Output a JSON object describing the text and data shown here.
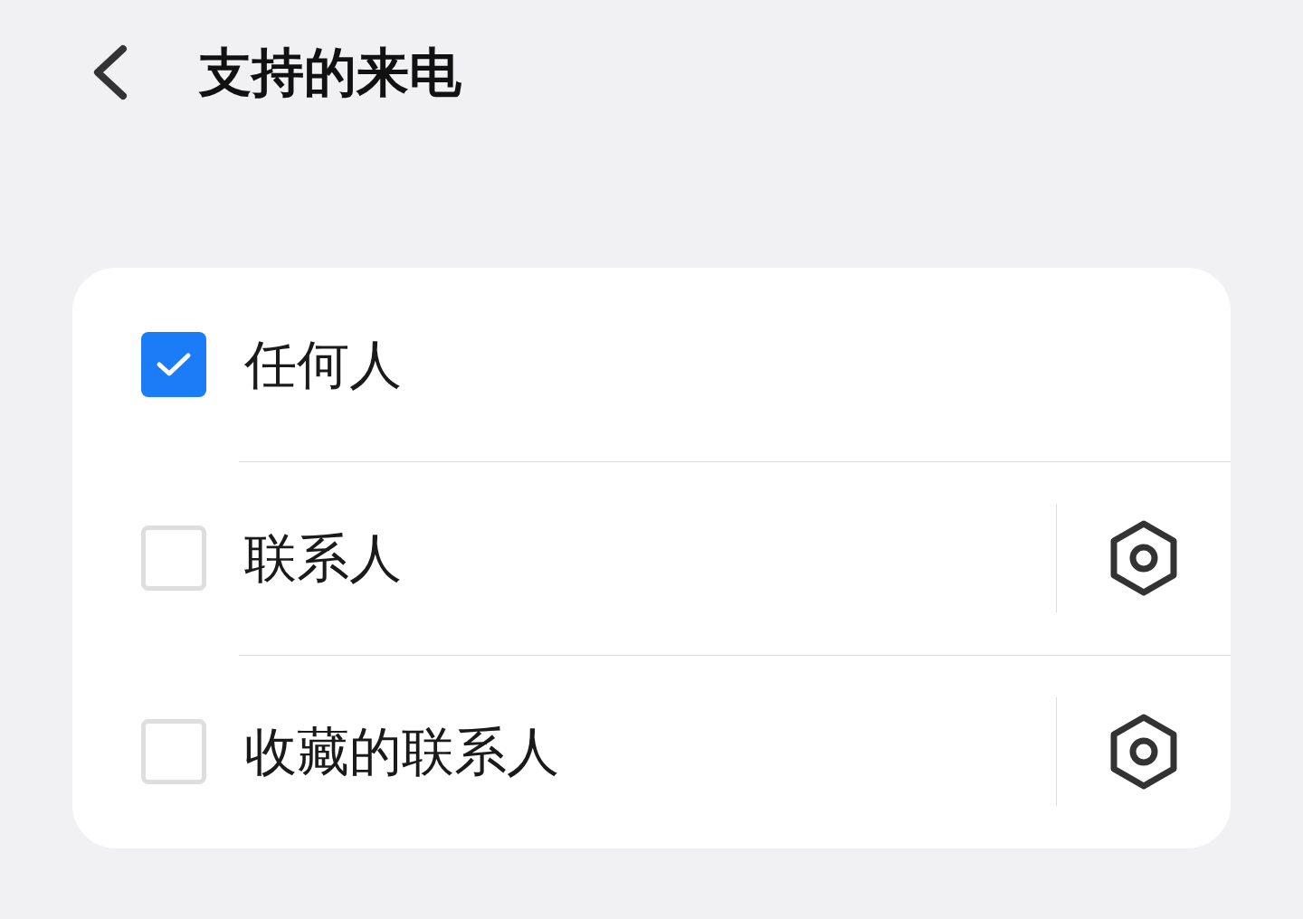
{
  "header": {
    "title": "支持的来电"
  },
  "options": [
    {
      "label": "任何人",
      "checked": true,
      "kind": "plain"
    },
    {
      "label": "联系人",
      "checked": false,
      "kind": "with-settings"
    },
    {
      "label": "收藏的联系人",
      "checked": false,
      "kind": "with-settings"
    }
  ]
}
